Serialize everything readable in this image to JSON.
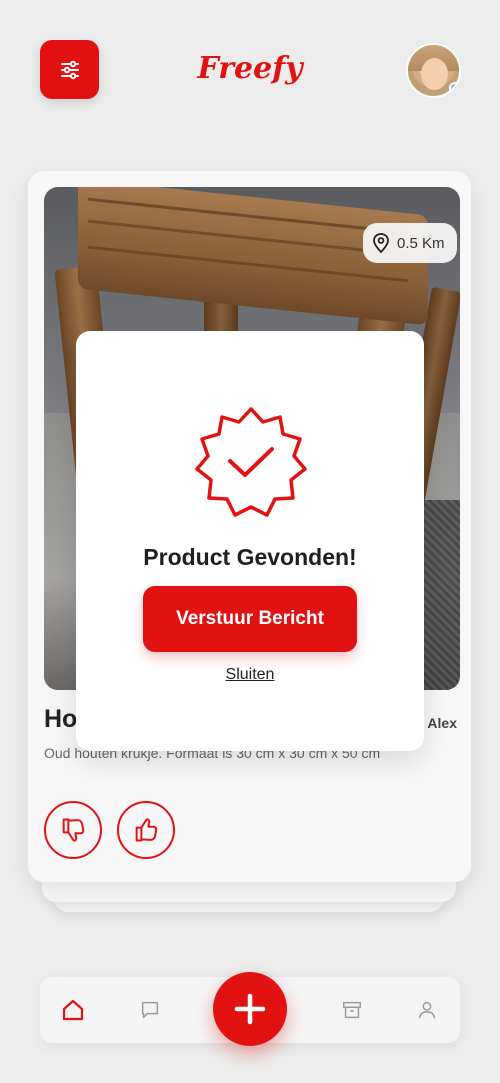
{
  "header": {
    "logo_text": "Freefy",
    "filter_icon": "sliders-icon",
    "avatar_icon": "user-avatar"
  },
  "product_card": {
    "distance": "0.5 Km",
    "distance_icon": "location-pin-icon",
    "title": "Houten krukje",
    "owner": "Alex",
    "description": "Oud houten krukje. Formaat is 30 cm x 30 cm x 50 cm",
    "dislike_icon": "thumbs-down-icon",
    "like_icon": "thumbs-up-icon"
  },
  "modal": {
    "icon": "verified-badge-icon",
    "heading": "Product Gevonden!",
    "send_button": "Verstuur Bericht",
    "close_link": "Sluiten"
  },
  "bottom_nav": {
    "items": [
      {
        "icon": "home-icon",
        "active": true
      },
      {
        "icon": "chat-icon",
        "active": false
      },
      {
        "icon": "plus-icon",
        "active": false
      },
      {
        "icon": "archive-icon",
        "active": false
      },
      {
        "icon": "profile-icon",
        "active": false
      }
    ]
  },
  "colors": {
    "accent": "#e31212",
    "background": "#ececec",
    "card": "#f7f7f7"
  }
}
